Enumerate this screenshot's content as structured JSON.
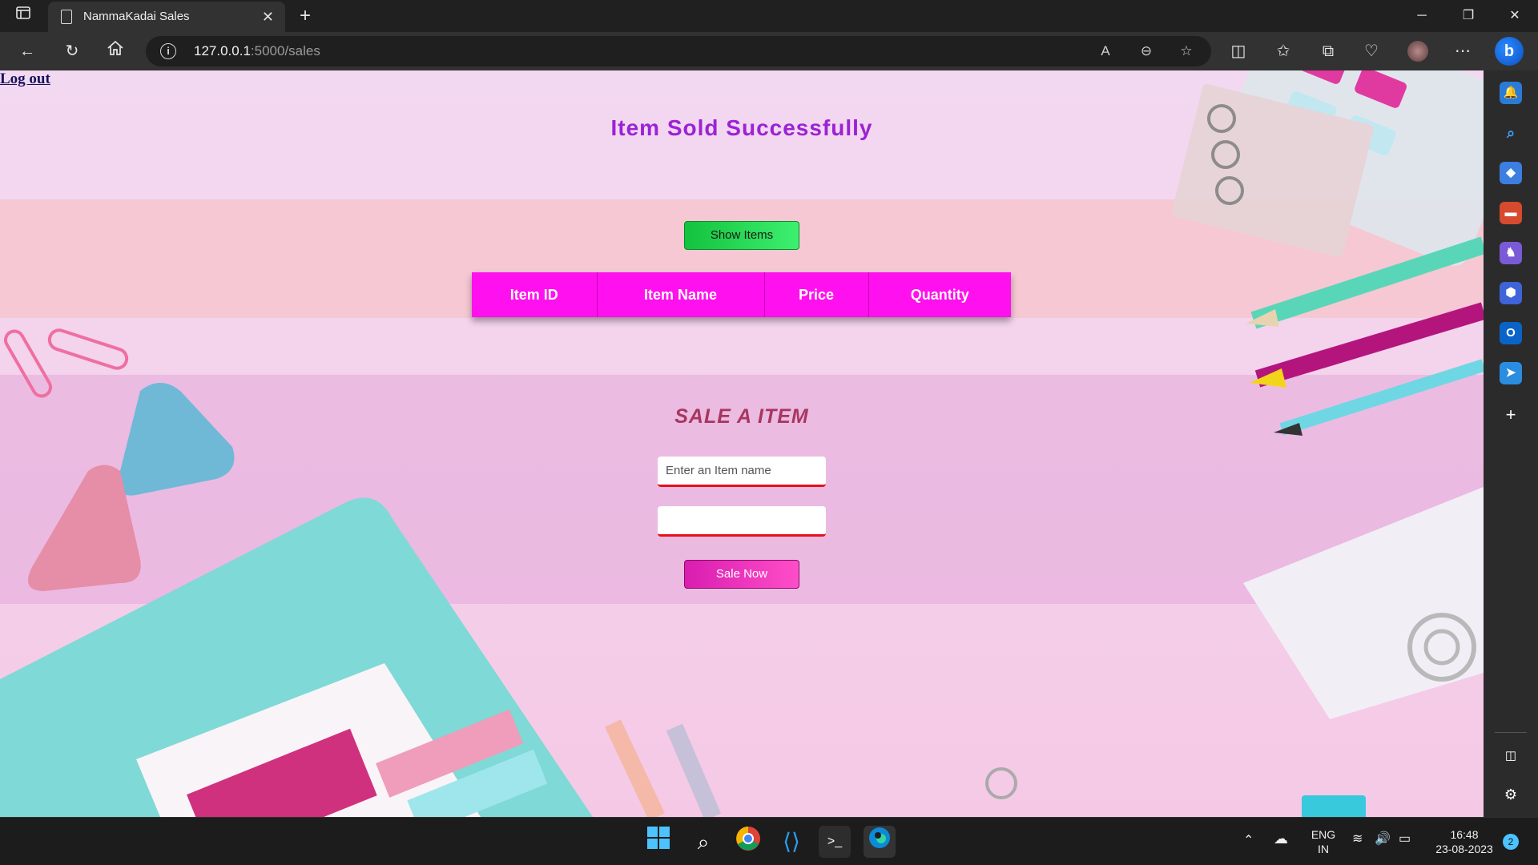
{
  "browser": {
    "tab_title": "NammaKadai Sales",
    "url_host": "127.0.0.1",
    "url_path": ":5000/sales"
  },
  "page": {
    "logout_label": "Log out",
    "status_message": "Item Sold Successfully",
    "show_items_label": "Show Items",
    "table_headers": [
      "Item ID",
      "Item Name",
      "Price",
      "Quantity"
    ],
    "sale_heading": "SALE A ITEM",
    "item_name_placeholder": "Enter an Item name",
    "quantity_value": "",
    "sale_button_label": "Sale Now"
  },
  "colors": {
    "status_text": "#9b22d6",
    "table_header_bg": "#ff10ee",
    "show_button": "#22d44f",
    "sale_button": "#e62fb9",
    "input_underline": "#e8101a"
  },
  "taskbar": {
    "language": "ENG",
    "region": "IN",
    "time": "16:48",
    "date": "23-08-2023",
    "notification_count": "2"
  }
}
